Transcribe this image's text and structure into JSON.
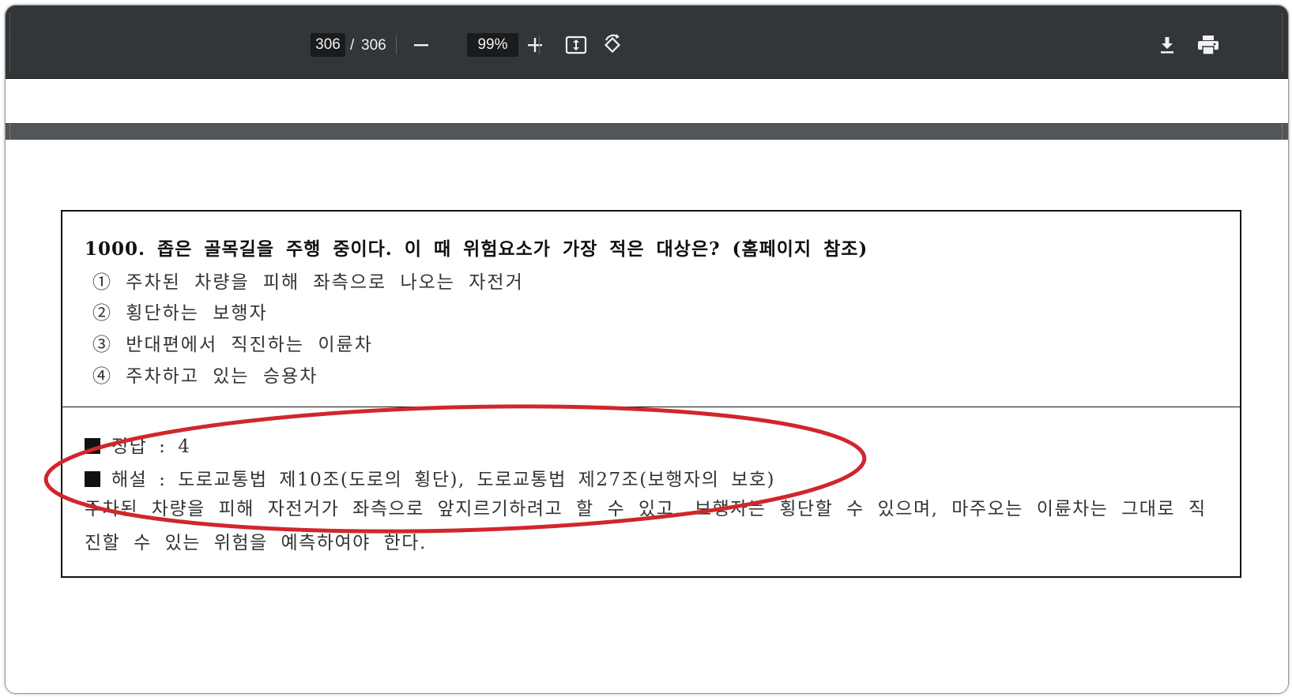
{
  "toolbar": {
    "current_page": "306",
    "separator": "/",
    "total_pages": "306",
    "zoom": "99%",
    "icons": {
      "zoom_out": "minus-icon",
      "zoom_in": "plus-icon",
      "fit": "fit-page-icon",
      "rotate": "rotate-icon",
      "download": "download-icon",
      "print": "print-icon"
    }
  },
  "document": {
    "question_title": "1000. 좁은 골목길을 주행 중이다. 이 때 위험요소가 가장 적은 대상은? (홈페이지 참조)",
    "options": [
      "① 주차된 차량을 피해 좌측으로 나오는 자전거",
      "② 횡단하는 보행자",
      "③ 반대편에서 직진하는 이륜차",
      "④ 주차하고 있는 승용차"
    ],
    "answer": "정답 : 4",
    "explanation_label": "해설 : 도로교통법 제10조(도로의 횡단), 도로교통법 제27조(보행자의 보호)",
    "explanation_text": "주차된 차량을 피해 자전거가 좌측으로 앞지르기하려고 할 수 있고, 보행자는 횡단할 수 있으며, 마주오는 이륜차는 그대로 직진할 수 있는 위험을 예측하여야 한다."
  },
  "annotation": {
    "highlight_color": "#d0262d"
  }
}
